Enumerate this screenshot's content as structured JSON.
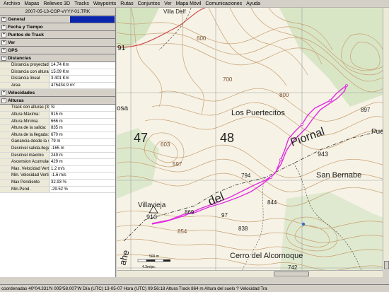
{
  "menu": [
    "Archivo",
    "Mapas",
    "Relieves 3D",
    "Tracks",
    "Waypoints",
    "Rutas",
    "Conjuntos",
    "Ver",
    "Mapa Móvil",
    "Comunicaciones",
    "Ayuda"
  ],
  "panel": {
    "file_title": "2007-05-13-CGP-vYYY-01.TRK",
    "sections": {
      "general": "General",
      "fecha": "Fecha y Tiempo",
      "puntos": "Puntos de Track",
      "ver": "Ver",
      "gps": "GPS",
      "distancias": "Distancias",
      "velocidades": "Velocidades",
      "alturas": "Alturas"
    },
    "distancias_rows": [
      {
        "label": "Distancia proyectada",
        "value": "14.74 Km"
      },
      {
        "label": "Distancia con alturas",
        "value": "15.09 Km"
      },
      {
        "label": "Distancia lineal",
        "value": "3.401 Km"
      },
      {
        "label": "Area",
        "value": "475434.9 m²"
      }
    ],
    "alturas_rows": [
      {
        "label": "Track con alturas (3D)",
        "value": "Si"
      },
      {
        "label": "Altura Máxima:",
        "value": "915 m"
      },
      {
        "label": "Altura Mínima:",
        "value": "666 m"
      },
      {
        "label": "Altura de la salida:",
        "value": "835 m"
      },
      {
        "label": "Altura de la llegada:",
        "value": "670 m"
      },
      {
        "label": "Ganancia desde la salida",
        "value": "79 m"
      },
      {
        "label": "Desnivel salida-llegada",
        "value": "-165 m"
      },
      {
        "label": "Desnivel máximo",
        "value": "249 m"
      },
      {
        "label": "Ascension Acumulada",
        "value": "429 m"
      },
      {
        "label": "Max. Velocidad Vertical",
        "value": "1.2 m/s"
      },
      {
        "label": "Min. Velocidad Vertical",
        "value": "-1.6 m/s"
      },
      {
        "label": "Max Pendiente",
        "value": "32.93 %"
      },
      {
        "label": "Min.Pend.",
        "value": "-29.52 %"
      }
    ]
  },
  "map": {
    "labels": {
      "villa_delf": "Villa Delf",
      "n91": "91",
      "n600": "600",
      "n700": "700",
      "n800": "800",
      "n897": "897",
      "puertecitos": "Los Puertecitos",
      "puert": "Puert",
      "osa": "osa",
      "n47": "47",
      "n48": "48",
      "n603": "603",
      "n597": "597",
      "piornal": "Piornal",
      "n943": "943",
      "san_bernabe": "San Bernabe",
      "n794": "794",
      "del": "del",
      "n844": "844",
      "villavieja": "Villavieja",
      "n910": "910",
      "n869": "869",
      "n97": "97",
      "n854": "854",
      "n838": "838",
      "cerro": "Cerro del Alcornoque",
      "n742": "742",
      "ahe": "ahe",
      "scale_500": "500 m",
      "scale_km": "4.3m/px."
    },
    "colors": {
      "contour": "#c8a070",
      "track": "#e02ce0",
      "grid": "#a0a0a0",
      "paper": "#f6f2e6",
      "green": "#c8dcb4"
    }
  },
  "status": {
    "text": "coordenadas 40º04.331'N 005º58.007'W Día (UTC) 13-05-07 Hora (UTC) 09:56:18 Altura Track 864 m Altura del suelo ? Velocidad Tra"
  }
}
